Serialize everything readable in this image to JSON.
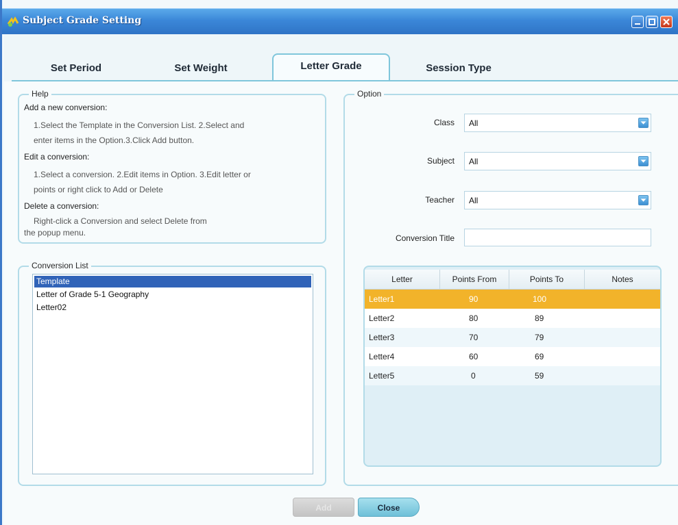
{
  "window": {
    "title": "Subject Grade Setting"
  },
  "tabs": [
    {
      "label": "Set Period"
    },
    {
      "label": "Set Weight"
    },
    {
      "label": "Letter Grade"
    },
    {
      "label": "Session Type"
    }
  ],
  "help": {
    "legend": "Help",
    "add_heading": "Add a new conversion:",
    "add_line1": "1.Select the Template in the Conversion List. 2.Select and",
    "add_line2": "enter items in the Option.3.Click Add button.",
    "edit_heading": "Edit a conversion:",
    "edit_line1": "1.Select a conversion. 2.Edit items in Option. 3.Edit letter or",
    "edit_line2": "points or right click to Add or Delete",
    "delete_heading": "Delete a conversion:",
    "delete_line1": "Right-click a Conversion and select Delete from",
    "delete_line2": "the popup menu."
  },
  "conversion_list": {
    "legend": "Conversion List",
    "items": [
      "Template",
      "Letter of Grade 5-1 Geography",
      "Letter02"
    ]
  },
  "option": {
    "legend": "Option",
    "class_label": "Class",
    "class_value": "All",
    "subject_label": "Subject",
    "subject_value": "All",
    "teacher_label": "Teacher",
    "teacher_value": "All",
    "title_label": "Conversion Title",
    "title_value": ""
  },
  "grid": {
    "columns": [
      "Letter",
      "Points From",
      "Points To",
      "Notes"
    ],
    "rows": [
      {
        "letter": "Letter1",
        "from": "90",
        "to": "100",
        "notes": ""
      },
      {
        "letter": "Letter2",
        "from": "80",
        "to": "89",
        "notes": ""
      },
      {
        "letter": "Letter3",
        "from": "70",
        "to": "79",
        "notes": ""
      },
      {
        "letter": "Letter4",
        "from": "60",
        "to": "69",
        "notes": ""
      },
      {
        "letter": "Letter5",
        "from": "0",
        "to": "59",
        "notes": ""
      }
    ]
  },
  "buttons": {
    "add_label": "Add",
    "close_label": "Close"
  },
  "colors": {
    "selection": "#3063b8",
    "row_highlight": "#f2b32a",
    "accent": "#7fc6db"
  }
}
